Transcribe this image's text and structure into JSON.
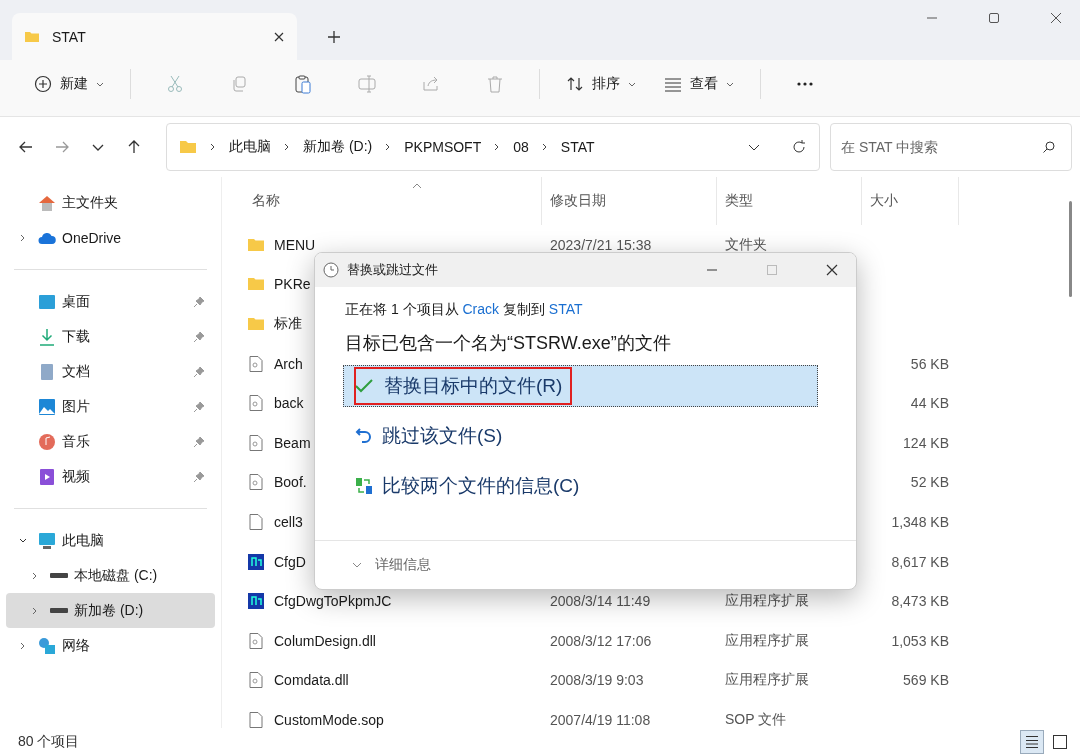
{
  "tab": {
    "title": "STAT"
  },
  "toolbar": {
    "new_label": "新建",
    "sort_label": "排序",
    "view_label": "查看"
  },
  "address": {
    "crumbs": [
      "此电脑",
      "新加卷 (D:)",
      "PKPMSOFT",
      "08",
      "STAT"
    ]
  },
  "search": {
    "placeholder": "在 STAT 中搜索"
  },
  "sidebar": {
    "sections": [
      [
        {
          "label": "主文件夹",
          "kind": "home",
          "selected": false
        },
        {
          "label": "OneDrive",
          "kind": "cloud",
          "expanded": false,
          "selected": false
        }
      ],
      [
        {
          "label": "桌面",
          "kind": "desktop",
          "pinned": true,
          "selected": false
        },
        {
          "label": "下载",
          "kind": "download",
          "pinned": true,
          "selected": false
        },
        {
          "label": "文档",
          "kind": "document",
          "pinned": true,
          "selected": false
        },
        {
          "label": "图片",
          "kind": "pictures",
          "pinned": true,
          "selected": false
        },
        {
          "label": "音乐",
          "kind": "music",
          "pinned": true,
          "selected": false
        },
        {
          "label": "视频",
          "kind": "video",
          "pinned": true,
          "selected": false
        }
      ],
      [
        {
          "label": "此电脑",
          "kind": "pc",
          "expanded": true,
          "selected": false,
          "children": [
            {
              "label": "本地磁盘 (C:)",
              "kind": "drive",
              "expanded": false,
              "selected": false
            },
            {
              "label": "新加卷 (D:)",
              "kind": "drive",
              "expanded": false,
              "selected": true
            }
          ]
        },
        {
          "label": "网络",
          "kind": "network",
          "expanded": false,
          "selected": false
        }
      ]
    ]
  },
  "table": {
    "columns": [
      "名称",
      "修改日期",
      "类型",
      "大小"
    ],
    "rows": [
      {
        "kind": "folder",
        "name": "MENU",
        "date": "2023/7/21 15:38",
        "type": "文件夹"
      },
      {
        "kind": "folder",
        "name": "PKRe"
      },
      {
        "kind": "folder",
        "name": "标准"
      },
      {
        "kind": "dll",
        "name": "Arch",
        "size": "56 KB"
      },
      {
        "kind": "dll",
        "name": "back",
        "size": "44 KB"
      },
      {
        "kind": "dll",
        "name": "Beam",
        "size": "124 KB"
      },
      {
        "kind": "dll",
        "name": "Boof.",
        "size": "52 KB"
      },
      {
        "kind": "file",
        "name": "cell3",
        "size": "1,348 KB"
      },
      {
        "kind": "app",
        "name": "CfgD",
        "size": "8,617 KB"
      },
      {
        "kind": "app",
        "name": "CfgDwgToPkpmJC",
        "date": "2008/3/14 11:49",
        "type": "应用程序扩展",
        "size": "8,473 KB"
      },
      {
        "kind": "dll",
        "name": "ColumDesign.dll",
        "date": "2008/3/12 17:06",
        "type": "应用程序扩展",
        "size": "1,053 KB"
      },
      {
        "kind": "dll",
        "name": "Comdata.dll",
        "date": "2008/3/19 9:03",
        "type": "应用程序扩展",
        "size": "569 KB"
      },
      {
        "kind": "file",
        "name": "CustomMode.sop",
        "date": "2007/4/19 11:08",
        "type": "SOP 文件"
      }
    ]
  },
  "dialog": {
    "title": "替换或跳过文件",
    "prefix": "正在将 1 个项目从",
    "source": "Crack",
    "middle": "复制到",
    "dest": "STAT",
    "message": "目标已包含一个名为“STSRW.exe”的文件",
    "options": [
      {
        "kind": "replace",
        "label": "替换目标中的文件(R)",
        "selected": true,
        "highlighted": true
      },
      {
        "kind": "skip",
        "label": "跳过该文件(S)",
        "selected": false,
        "highlighted": false
      },
      {
        "kind": "compare",
        "label": "比较两个文件的信息(C)",
        "selected": false,
        "highlighted": false
      }
    ],
    "details": "详细信息"
  },
  "status_bar": {
    "count": "80 个项目",
    "views": [
      {
        "kind": "details",
        "selected": true
      },
      {
        "kind": "tiles",
        "selected": false
      }
    ]
  }
}
